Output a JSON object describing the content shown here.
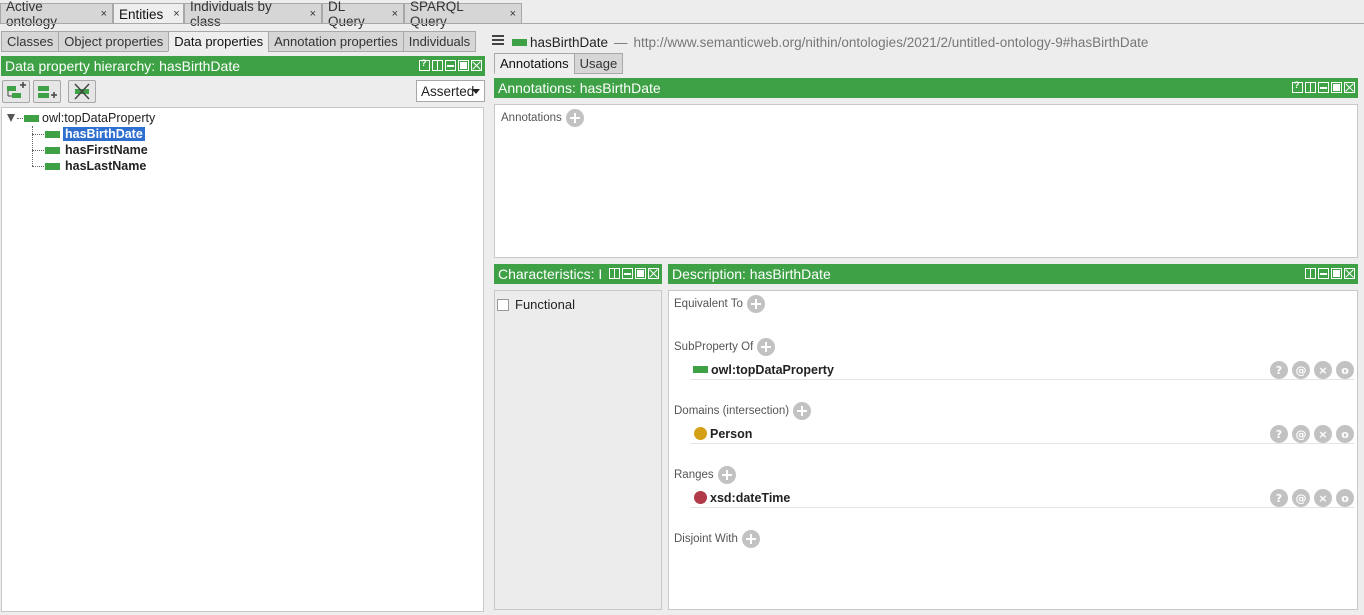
{
  "top_tabs": [
    {
      "label": "Active ontology"
    },
    {
      "label": "Entities"
    },
    {
      "label": "Individuals by class"
    },
    {
      "label": "DL Query"
    },
    {
      "label": "SPARQL Query"
    }
  ],
  "close_glyph": "×",
  "left": {
    "tabs": [
      "Classes",
      "Object properties",
      "Data properties",
      "Annotation properties",
      "Individuals"
    ],
    "hierarchy_title": "Data property hierarchy: hasBirthDate",
    "select_value": "Asserted",
    "tree": {
      "root": "owl:topDataProperty",
      "children": [
        "hasBirthDate",
        "hasFirstName",
        "hasLastName"
      ]
    }
  },
  "right": {
    "entity_name": "hasBirthDate",
    "entity_sep": "—",
    "entity_uri": "http://www.semanticweb.org/nithin/ontologies/2021/2/untitled-ontology-9#hasBirthDate",
    "tabs": [
      "Annotations",
      "Usage"
    ],
    "annotations_title": "Annotations: hasBirthDate",
    "annotations_label": "Annotations",
    "characteristics_title": "Characteristics: I",
    "functional_label": "Functional",
    "description_title": "Description: hasBirthDate",
    "sections": {
      "equivalent_to": "Equivalent To",
      "subproperty_of": "SubProperty Of",
      "subproperty_value": "owl:topDataProperty",
      "domains": "Domains (intersection)",
      "domain_value": "Person",
      "ranges": "Ranges",
      "range_value": "xsd:dateTime",
      "disjoint_with": "Disjoint With"
    },
    "row_action_glyphs": [
      "?",
      "@",
      "×",
      "o"
    ]
  },
  "colors": {
    "accent_green": "#3ea146",
    "selection_blue": "#2f6fcf",
    "class_yellow": "#d4a017",
    "datatype_red": "#b03a48"
  }
}
